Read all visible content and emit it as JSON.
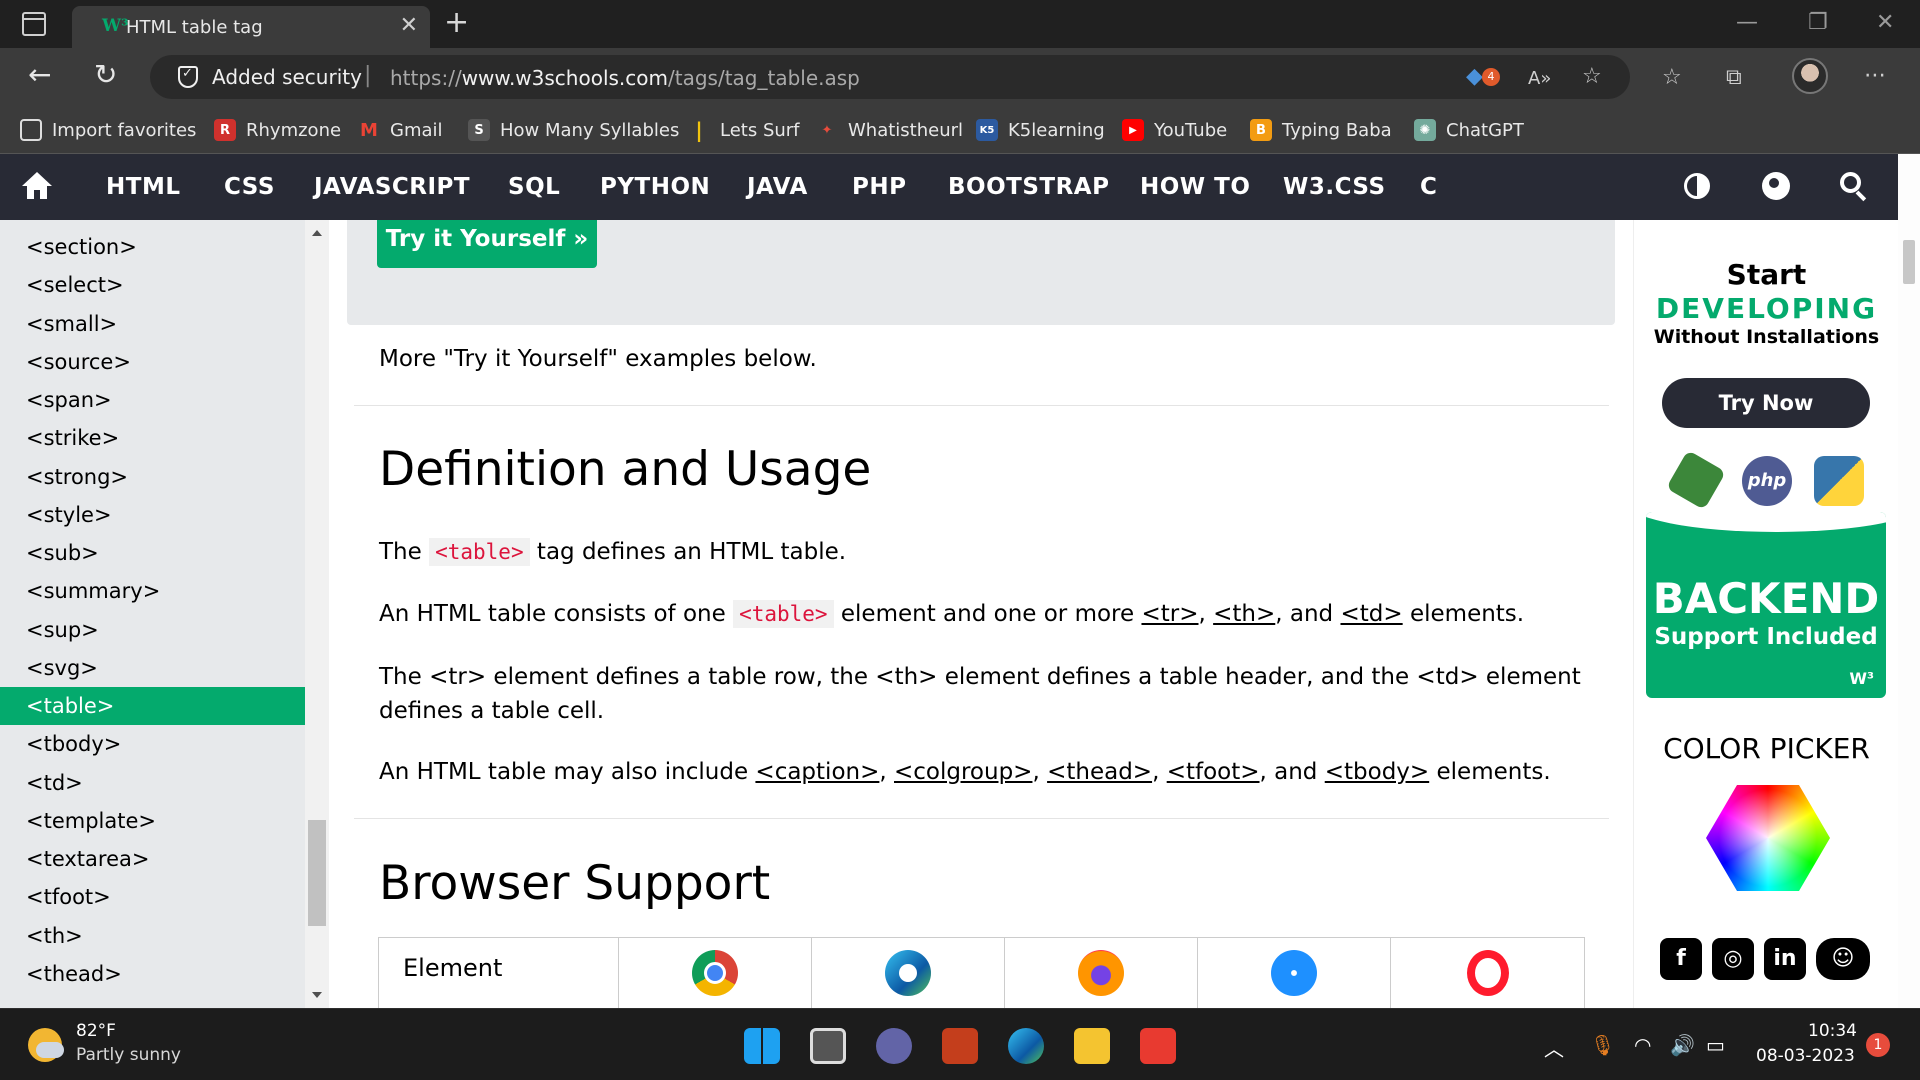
{
  "browser": {
    "tab_title": "HTML table tag",
    "tab_favicon": "W³",
    "close_glyph": "✕",
    "new_tab_glyph": "+",
    "security_label": "Added security",
    "url_prefix": "https://",
    "url_domain": "www.w3schools.com",
    "url_path": "/tags/tag_table.asp",
    "extension_badge": "4",
    "read_aloud_glyph": "A»",
    "bookmarks": [
      {
        "label": "Import favorites",
        "icon": "import-icon",
        "color": "#3b3b3b"
      },
      {
        "label": "Rhymzone",
        "icon": "rhymezone-icon",
        "color": "#d0312d",
        "glyph": "R"
      },
      {
        "label": "Gmail",
        "icon": "gmail-icon",
        "color": "#ea4335",
        "glyph": "M"
      },
      {
        "label": "How Many Syllables",
        "icon": "syllables-icon",
        "color": "#444444",
        "glyph": "S"
      },
      {
        "label": "Lets Surf",
        "icon": "surf-icon",
        "color": "#f1c40f",
        "glyph": "|"
      },
      {
        "label": "Whatistheurl",
        "icon": "whatistheurl-icon",
        "color": "#c0392b",
        "glyph": "✦"
      },
      {
        "label": "K5learning",
        "icon": "k5-icon",
        "color": "#2c5aa0",
        "glyph": "K5"
      },
      {
        "label": "YouTube",
        "icon": "youtube-icon",
        "color": "#ff0000",
        "glyph": "▶"
      },
      {
        "label": "Typing Baba",
        "icon": "typingbaba-icon",
        "color": "#f39c12",
        "glyph": "B"
      },
      {
        "label": "ChatGPT",
        "icon": "chatgpt-icon",
        "color": "#74aa9c",
        "glyph": "✺"
      }
    ]
  },
  "w3nav": {
    "items": [
      "HTML",
      "CSS",
      "JAVASCRIPT",
      "SQL",
      "PYTHON",
      "JAVA",
      "PHP",
      "BOOTSTRAP",
      "HOW TO",
      "W3.CSS",
      "C"
    ]
  },
  "sidebar": {
    "items": [
      "<section>",
      "<select>",
      "<small>",
      "<source>",
      "<span>",
      "<strike>",
      "<strong>",
      "<style>",
      "<sub>",
      "<summary>",
      "<sup>",
      "<svg>",
      "<table>",
      "<tbody>",
      "<td>",
      "<template>",
      "<textarea>",
      "<tfoot>",
      "<th>",
      "<thead>"
    ],
    "active": "<table>",
    "active_color": "#04aa6d"
  },
  "main": {
    "try_button": "Try it Yourself »",
    "more_examples": "More \"Try it Yourself\" examples below.",
    "definition_heading": "Definition and Usage",
    "p1": {
      "pre": "The ",
      "code": "<table>",
      "post": " tag defines an HTML table."
    },
    "p2": {
      "pre": "An HTML table consists of one ",
      "code": "<table>",
      "mid": " element and one or more ",
      "link1": "<tr>",
      "sep1": ", ",
      "link2": "<th>",
      "sep2": ", and ",
      "link3": "<td>",
      "post": " elements."
    },
    "p3": "The <tr> element defines a table row, the <th> element defines a table header, and the <td> element defines a table cell.",
    "p4": {
      "pre": "An HTML table may also include ",
      "link1": "<caption>",
      "sep1": ", ",
      "link2": "<colgroup>",
      "sep2": ", ",
      "link3": "<thead>",
      "sep3": ", ",
      "link4": "<tfoot>",
      "sep4": ", and ",
      "link5": "<tbody>",
      "post": " elements."
    },
    "browser_heading": "Browser Support",
    "table_first_col": "Element",
    "browser_icons": [
      "chrome-icon",
      "edge-icon",
      "firefox-icon",
      "safari-icon",
      "opera-icon"
    ]
  },
  "right_ad": {
    "start": "Start",
    "developing": "DEVELOPING",
    "without": "Without Installations",
    "try_now": "Try Now",
    "php_label": "php",
    "backend_title": "BACKEND",
    "backend_sub": "Support Included",
    "backend_logo": "W³",
    "color_picker": "COLOR PICKER",
    "social_glyphs": {
      "facebook": "f",
      "instagram": "◎",
      "linkedin": "in",
      "discord": "☺"
    }
  },
  "taskbar": {
    "temp": "82°F",
    "weather": "Partly sunny",
    "time": "10:34",
    "date": "08-03-2023",
    "notifications": "1"
  }
}
